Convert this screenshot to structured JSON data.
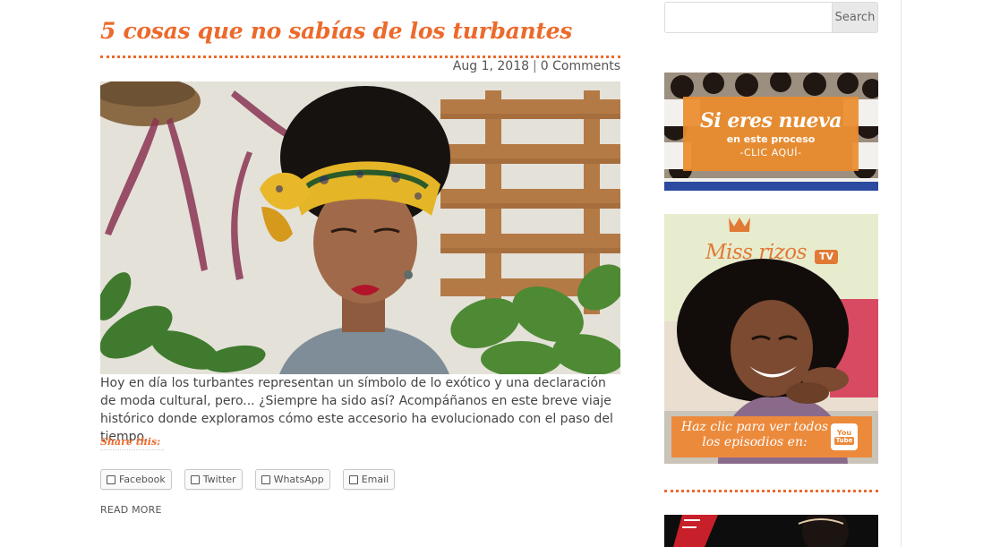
{
  "post": {
    "title": "5 cosas que no sabías de los turbantes",
    "date": "Aug 1, 2018",
    "meta_separator": "|",
    "comments": "0 Comments",
    "excerpt": "Hoy en día los turbantes representan un símbolo de lo exótico y una declaración de moda cultural, pero... ¿Siempre ha sido así? Acompáñanos en este breve viaje histórico donde exploramos cómo este accesorio ha evolucionado con el paso del tiempo.",
    "share_title": "Share this:",
    "share_buttons": [
      "Facebook",
      "Twitter",
      "WhatsApp",
      "Email"
    ],
    "read_more": "READ MORE"
  },
  "sidebar": {
    "search": {
      "value": "",
      "placeholder": "",
      "button_label": "Search"
    },
    "promo": {
      "headline": "Si eres nueva",
      "subline": "en este proceso",
      "cta": "-CLIC AQUÍ-"
    },
    "tv": {
      "brand": "Miss rizos",
      "badge": "TV",
      "cta": "Haz clic para ver todos los episodios en:",
      "yt_you": "You",
      "yt_tube": "Tube"
    }
  },
  "colors": {
    "accent": "#ec6a2c",
    "promo_orange": "#ec8a3c",
    "text": "#444444",
    "tv_background": "#e6ebcd"
  },
  "icons": {
    "share_checkbox": "checkbox-icon",
    "youtube": "youtube-icon",
    "crown": "crown-icon"
  }
}
